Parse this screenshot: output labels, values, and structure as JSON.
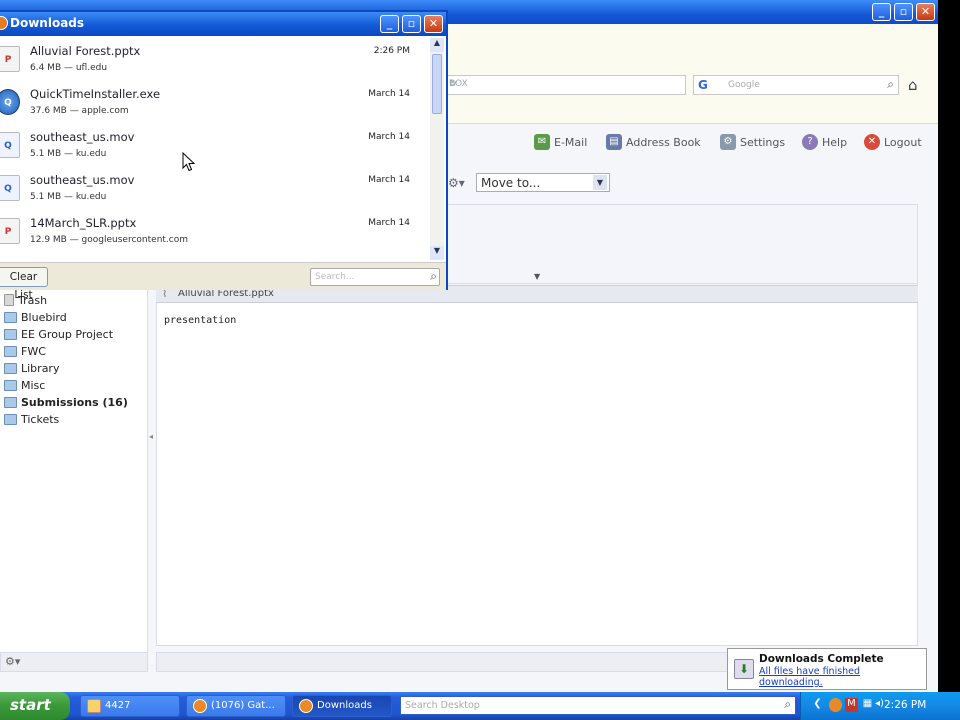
{
  "browser": {
    "url_partial": "BOX",
    "google_placeholder": "Google",
    "toolbar": {
      "email": "E-Mail",
      "address_book": "Address Book",
      "settings": "Settings",
      "help": "Help",
      "logout": "Logout"
    },
    "move_to": "Move to...",
    "attachment_name": "Alluvial Forest.pptx",
    "message_body": "presentation",
    "folders": [
      {
        "label": "Trash"
      },
      {
        "label": "Bluebird"
      },
      {
        "label": "EE Group Project"
      },
      {
        "label": "FWC"
      },
      {
        "label": "Library"
      },
      {
        "label": "Misc"
      },
      {
        "label": "Submissions (16)"
      },
      {
        "label": "Tickets"
      }
    ]
  },
  "downloads": {
    "title": "Downloads",
    "items": [
      {
        "name": "Alluvial Forest.pptx",
        "meta": "6.4 MB — ufl.edu",
        "date": "2:26 PM",
        "icon": "pptx-file-icon"
      },
      {
        "name": "QuickTimeInstaller.exe",
        "meta": "37.6 MB — apple.com",
        "date": "March 14",
        "icon": "quicktime-icon"
      },
      {
        "name": "southeast_us.mov",
        "meta": "5.1 MB — ku.edu",
        "date": "March 14",
        "icon": "movie-file-icon"
      },
      {
        "name": "southeast_us.mov",
        "meta": "5.1 MB — ku.edu",
        "date": "March 14",
        "icon": "movie-file-icon"
      },
      {
        "name": "14March_SLR.pptx",
        "meta": "12.9 MB — googleusercontent.com",
        "date": "March 14",
        "icon": "pptx-file-icon"
      }
    ],
    "clear_list": "Clear List",
    "search_placeholder": "Search..."
  },
  "notification": {
    "title": "Downloads Complete",
    "subtitle": "All files have finished downloading."
  },
  "taskbar": {
    "start": "start",
    "tasks": [
      {
        "label": "4427"
      },
      {
        "label": "(1076) Gat..."
      },
      {
        "label": "Downloads"
      }
    ],
    "search_placeholder": "Search Desktop",
    "clock": "2:26 PM"
  }
}
